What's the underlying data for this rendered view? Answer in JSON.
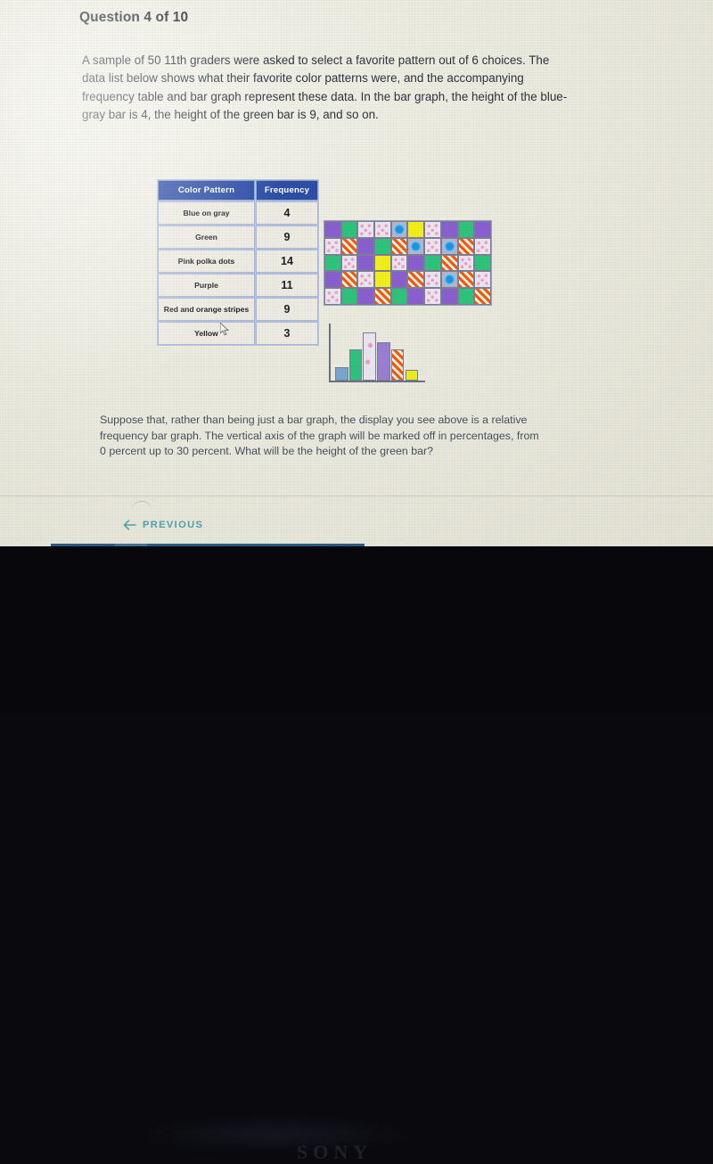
{
  "question": {
    "title": "Question 4 of 10",
    "body": "A sample of 50 11th graders were asked to select a favorite pattern out of 6 choices. The data list below shows what their favorite color patterns were, and the accompanying frequency table and bar graph represent these data. In the bar graph, the height of the blue-gray bar is 4, the height of the green bar is 9, and so on.",
    "footer": "Suppose that, rather than being just a bar graph, the display you see above is a relative frequency bar graph. The vertical axis of the graph will be marked off in percentages, from 0 percent up to 30 percent. What will be the height of the green bar?"
  },
  "table": {
    "headers": [
      "Color Pattern",
      "Frequency"
    ],
    "rows": [
      {
        "label": "Blue on gray",
        "value": "4"
      },
      {
        "label": "Green",
        "value": "9"
      },
      {
        "label": "Pink polka dots",
        "value": "14"
      },
      {
        "label": "Purple",
        "value": "11"
      },
      {
        "label": "Red and orange stripes",
        "value": "9"
      },
      {
        "label": "Yellow",
        "value": "3"
      }
    ],
    "header_color": "#2c4ea6",
    "cell_color": "#eeece2"
  },
  "chart_data": {
    "type": "bar",
    "title": "",
    "xlabel": "",
    "ylabel": "",
    "categories": [
      "Blue on gray",
      "Green",
      "Pink polka dots",
      "Purple",
      "Red and orange stripes",
      "Yellow"
    ],
    "values": [
      4,
      9,
      14,
      11,
      9,
      3
    ],
    "ylim": [
      0,
      15
    ],
    "grid": false,
    "legend": "none",
    "bar_colors": [
      "#7aa7cf",
      "#2ec27e",
      "#e9e6ef",
      "#9b7fd4",
      "#f05a10",
      "#eded1c"
    ],
    "total": 50
  },
  "swatch_grid": {
    "columns": 10,
    "rows": 5,
    "legend": {
      "purple": "Purple",
      "green": "Green",
      "yellow": "Yellow",
      "pink": "Pink polka dots",
      "stripes": "Red and orange stripes",
      "bluegray": "Blue on gray"
    },
    "cells": [
      "purple",
      "green",
      "pink",
      "pink",
      "bluegray",
      "yellow",
      "pink",
      "purple",
      "green",
      "purple",
      "pink",
      "stripes",
      "purple",
      "green",
      "stripes",
      "bluegray",
      "pink",
      "bluegray",
      "stripes",
      "pink",
      "green",
      "pink",
      "purple",
      "yellow",
      "pink",
      "purple",
      "green",
      "stripes",
      "pink",
      "green",
      "purple",
      "stripes",
      "pink",
      "yellow",
      "purple",
      "stripes",
      "pink",
      "bluegray",
      "stripes",
      "pink",
      "pink",
      "green",
      "purple",
      "stripes",
      "green",
      "purple",
      "pink",
      "purple",
      "green",
      "stripes"
    ]
  },
  "nav": {
    "previous_label": "PREVIOUS",
    "previous_icon": "arrow-left-icon",
    "accent_color": "#4fa3a8"
  },
  "taskbar": {
    "items": [
      {
        "name": "cortana-search-icon",
        "label": ""
      },
      {
        "name": "task-view-icon",
        "label": ""
      },
      {
        "name": "edge-browser-icon",
        "label": ""
      },
      {
        "name": "file-explorer-icon",
        "label": ""
      },
      {
        "name": "microsoft-store-icon",
        "label": ""
      },
      {
        "name": "mail-icon",
        "label": ""
      },
      {
        "name": "media-app-icon",
        "label": ""
      },
      {
        "name": "settings-gear-icon",
        "label": ""
      }
    ],
    "background_color": "#2a5b87"
  },
  "device": {
    "brand": "SONY"
  }
}
